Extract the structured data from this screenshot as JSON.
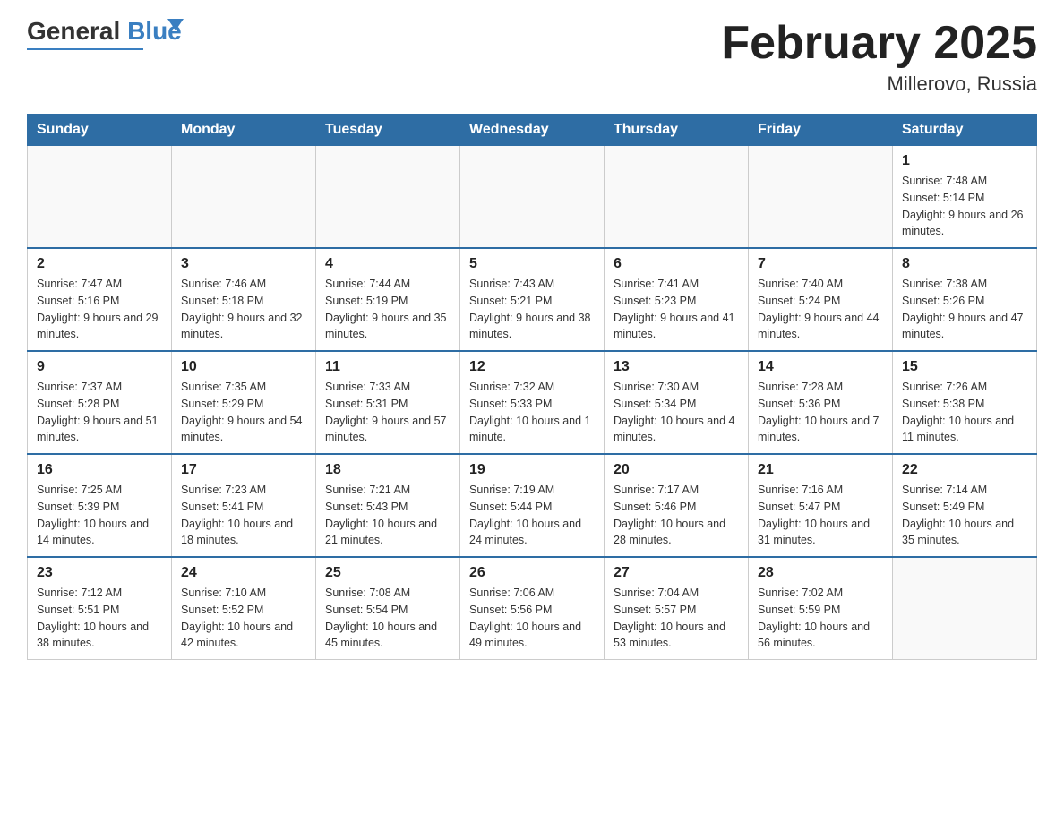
{
  "header": {
    "logo_main": "General",
    "logo_accent": "Blue",
    "month_title": "February 2025",
    "location": "Millerovo, Russia"
  },
  "weekdays": [
    "Sunday",
    "Monday",
    "Tuesday",
    "Wednesday",
    "Thursday",
    "Friday",
    "Saturday"
  ],
  "weeks": [
    [
      {
        "day": "",
        "info": ""
      },
      {
        "day": "",
        "info": ""
      },
      {
        "day": "",
        "info": ""
      },
      {
        "day": "",
        "info": ""
      },
      {
        "day": "",
        "info": ""
      },
      {
        "day": "",
        "info": ""
      },
      {
        "day": "1",
        "info": "Sunrise: 7:48 AM\nSunset: 5:14 PM\nDaylight: 9 hours and 26 minutes."
      }
    ],
    [
      {
        "day": "2",
        "info": "Sunrise: 7:47 AM\nSunset: 5:16 PM\nDaylight: 9 hours and 29 minutes."
      },
      {
        "day": "3",
        "info": "Sunrise: 7:46 AM\nSunset: 5:18 PM\nDaylight: 9 hours and 32 minutes."
      },
      {
        "day": "4",
        "info": "Sunrise: 7:44 AM\nSunset: 5:19 PM\nDaylight: 9 hours and 35 minutes."
      },
      {
        "day": "5",
        "info": "Sunrise: 7:43 AM\nSunset: 5:21 PM\nDaylight: 9 hours and 38 minutes."
      },
      {
        "day": "6",
        "info": "Sunrise: 7:41 AM\nSunset: 5:23 PM\nDaylight: 9 hours and 41 minutes."
      },
      {
        "day": "7",
        "info": "Sunrise: 7:40 AM\nSunset: 5:24 PM\nDaylight: 9 hours and 44 minutes."
      },
      {
        "day": "8",
        "info": "Sunrise: 7:38 AM\nSunset: 5:26 PM\nDaylight: 9 hours and 47 minutes."
      }
    ],
    [
      {
        "day": "9",
        "info": "Sunrise: 7:37 AM\nSunset: 5:28 PM\nDaylight: 9 hours and 51 minutes."
      },
      {
        "day": "10",
        "info": "Sunrise: 7:35 AM\nSunset: 5:29 PM\nDaylight: 9 hours and 54 minutes."
      },
      {
        "day": "11",
        "info": "Sunrise: 7:33 AM\nSunset: 5:31 PM\nDaylight: 9 hours and 57 minutes."
      },
      {
        "day": "12",
        "info": "Sunrise: 7:32 AM\nSunset: 5:33 PM\nDaylight: 10 hours and 1 minute."
      },
      {
        "day": "13",
        "info": "Sunrise: 7:30 AM\nSunset: 5:34 PM\nDaylight: 10 hours and 4 minutes."
      },
      {
        "day": "14",
        "info": "Sunrise: 7:28 AM\nSunset: 5:36 PM\nDaylight: 10 hours and 7 minutes."
      },
      {
        "day": "15",
        "info": "Sunrise: 7:26 AM\nSunset: 5:38 PM\nDaylight: 10 hours and 11 minutes."
      }
    ],
    [
      {
        "day": "16",
        "info": "Sunrise: 7:25 AM\nSunset: 5:39 PM\nDaylight: 10 hours and 14 minutes."
      },
      {
        "day": "17",
        "info": "Sunrise: 7:23 AM\nSunset: 5:41 PM\nDaylight: 10 hours and 18 minutes."
      },
      {
        "day": "18",
        "info": "Sunrise: 7:21 AM\nSunset: 5:43 PM\nDaylight: 10 hours and 21 minutes."
      },
      {
        "day": "19",
        "info": "Sunrise: 7:19 AM\nSunset: 5:44 PM\nDaylight: 10 hours and 24 minutes."
      },
      {
        "day": "20",
        "info": "Sunrise: 7:17 AM\nSunset: 5:46 PM\nDaylight: 10 hours and 28 minutes."
      },
      {
        "day": "21",
        "info": "Sunrise: 7:16 AM\nSunset: 5:47 PM\nDaylight: 10 hours and 31 minutes."
      },
      {
        "day": "22",
        "info": "Sunrise: 7:14 AM\nSunset: 5:49 PM\nDaylight: 10 hours and 35 minutes."
      }
    ],
    [
      {
        "day": "23",
        "info": "Sunrise: 7:12 AM\nSunset: 5:51 PM\nDaylight: 10 hours and 38 minutes."
      },
      {
        "day": "24",
        "info": "Sunrise: 7:10 AM\nSunset: 5:52 PM\nDaylight: 10 hours and 42 minutes."
      },
      {
        "day": "25",
        "info": "Sunrise: 7:08 AM\nSunset: 5:54 PM\nDaylight: 10 hours and 45 minutes."
      },
      {
        "day": "26",
        "info": "Sunrise: 7:06 AM\nSunset: 5:56 PM\nDaylight: 10 hours and 49 minutes."
      },
      {
        "day": "27",
        "info": "Sunrise: 7:04 AM\nSunset: 5:57 PM\nDaylight: 10 hours and 53 minutes."
      },
      {
        "day": "28",
        "info": "Sunrise: 7:02 AM\nSunset: 5:59 PM\nDaylight: 10 hours and 56 minutes."
      },
      {
        "day": "",
        "info": ""
      }
    ]
  ]
}
